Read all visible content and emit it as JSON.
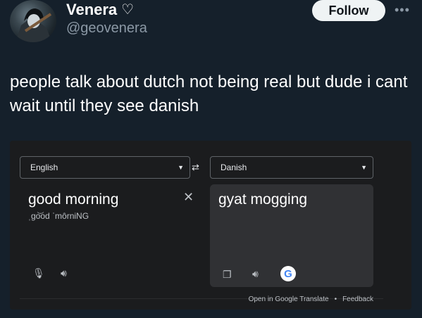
{
  "tweet": {
    "display_name": "Venera",
    "heart_icon": "heart-outline-icon",
    "handle": "@geovenera",
    "follow_label": "Follow",
    "more_icon": "more-horizontal-icon",
    "text": "people talk about dutch not being real but dude i cant wait until they see danish"
  },
  "translate": {
    "source_language": "English",
    "target_language": "Danish",
    "source_text": "good morning",
    "source_phonetic": "ˌɡo͝od ˈmôrniNG",
    "target_text": "gyat mogging",
    "footer_open": "Open in Google Translate",
    "footer_feedback": "Feedback",
    "footer_separator": "•",
    "google_glyph": "G"
  },
  "colors": {
    "background": "#15202b",
    "card": "#1b1c1e",
    "target_pane": "#303134",
    "follow_bg": "#eff3f4"
  }
}
